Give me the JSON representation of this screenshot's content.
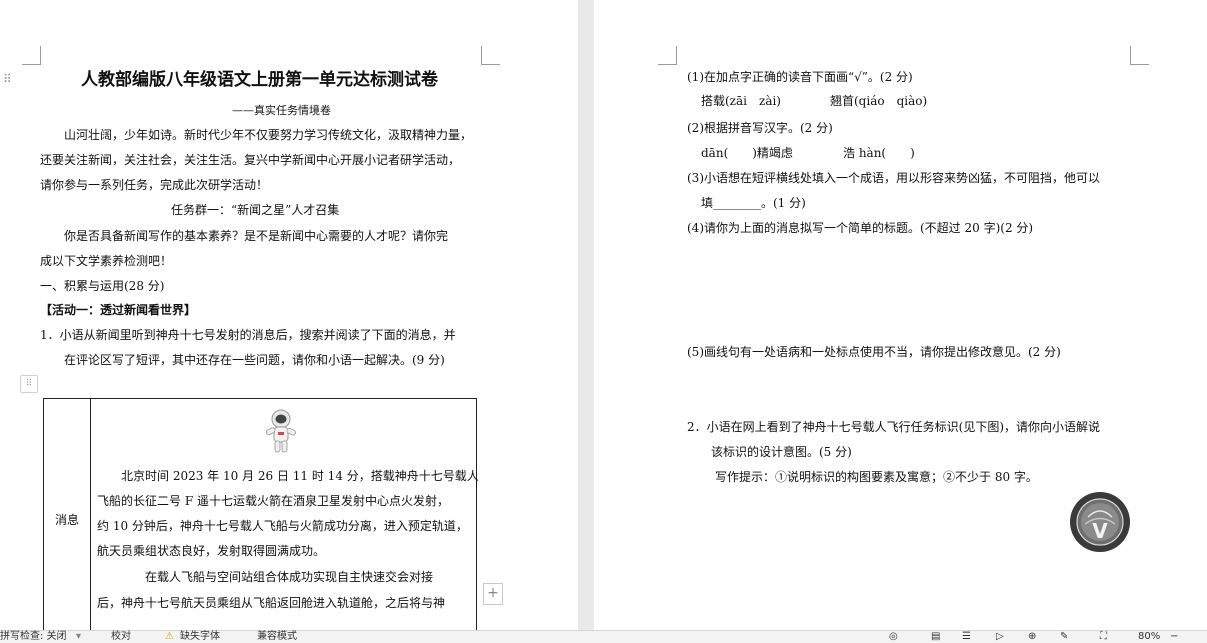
{
  "left_page": {
    "title": "人教部编版八年级语文上册第一单元达标测试卷",
    "subtitle": "——真实任务情境卷",
    "intro": [
      "山河壮阔，少年如诗。新时代少年不仅要努力学习传统文化，汲取精神力量，",
      "还要关注新闻，关注社会，关注生活。复兴中学新闻中心开展小记者研学活动，",
      "请你参与一系列任务，完成此次研学活动！"
    ],
    "task_group": "任务群一：“新闻之星”人才召集",
    "task_intro": [
      "你是否具备新闻写作的基本素养？是不是新闻中心需要的人才呢？请你完",
      "成以下文学素养检测吧！"
    ],
    "section_one": "一、积累与运用(28 分)",
    "activity_one": "【活动一：透过新闻看世界】",
    "q1": [
      "1．小语从新闻里听到神舟十七号发射的消息后，搜索并阅读了下面的消息，并",
      "在评论区写了短评，其中还存在一些问题，请你和小语一起解决。(9 分)"
    ],
    "table": {
      "label": "消息",
      "paragraph1": [
        "北京时间 2023 年 10 月 26 日 11 时 14 分，搭载神舟十七号载人",
        "飞船的长征二号 F 遥十七运载火箭在酒泉卫星发射中心点火发射，",
        "约 10 分钟后，神舟十七号载人飞船与火箭成功分离，进入预定轨道，",
        "航天员乘组状态良好，发射取得圆满成功。"
      ],
      "paragraph2": [
        "在载人飞船与空间站组合体成功实现自主快速交会对接",
        "后，神舟十七号航天员乘组从飞船返回舱进入轨道舱，之后将与神"
      ]
    }
  },
  "right_page": {
    "q1_1": "(1)在加点字正确的读音下面画“√”。(2 分)",
    "q1_1_opts": [
      "搭载(zāi　zài)",
      "翘首(qiáo　qiào)"
    ],
    "q1_2": "(2)根据拼音写汉字。(2 分)",
    "q1_2_opts": [
      "dān(　　)精竭虑",
      "浩 hàn(　　)"
    ],
    "q1_3": [
      "(3)小语想在短评横线处填入一个成语，用以形容来势凶猛，不可阻挡，他可以",
      "填________。(1 分)"
    ],
    "q1_4": "(4)请你为上面的消息拟写一个简单的标题。(不超过 20 字)(2 分)",
    "q1_5": "(5)画线句有一处语病和一处标点使用不当，请你提出修改意见。(2 分)",
    "q2": [
      "2．小语在网上看到了神舟十七号载人飞行任务标识(见下图)，请你向小语解说",
      "该标识的设计意图。(5 分)"
    ],
    "q2_hint": "写作提示：①说明标识的构图要素及寓意；②不少于 80 字。",
    "logo_letter": "V"
  },
  "statusbar": {
    "spellcheck": "拼写检查: 关闭",
    "proofread": "校对",
    "missing_font": "缺失字体",
    "compat_mode": "兼容模式",
    "zoom": "80%"
  },
  "colors": {
    "accent_warning": "#e0a000",
    "workspace": "#e9e9e9"
  }
}
